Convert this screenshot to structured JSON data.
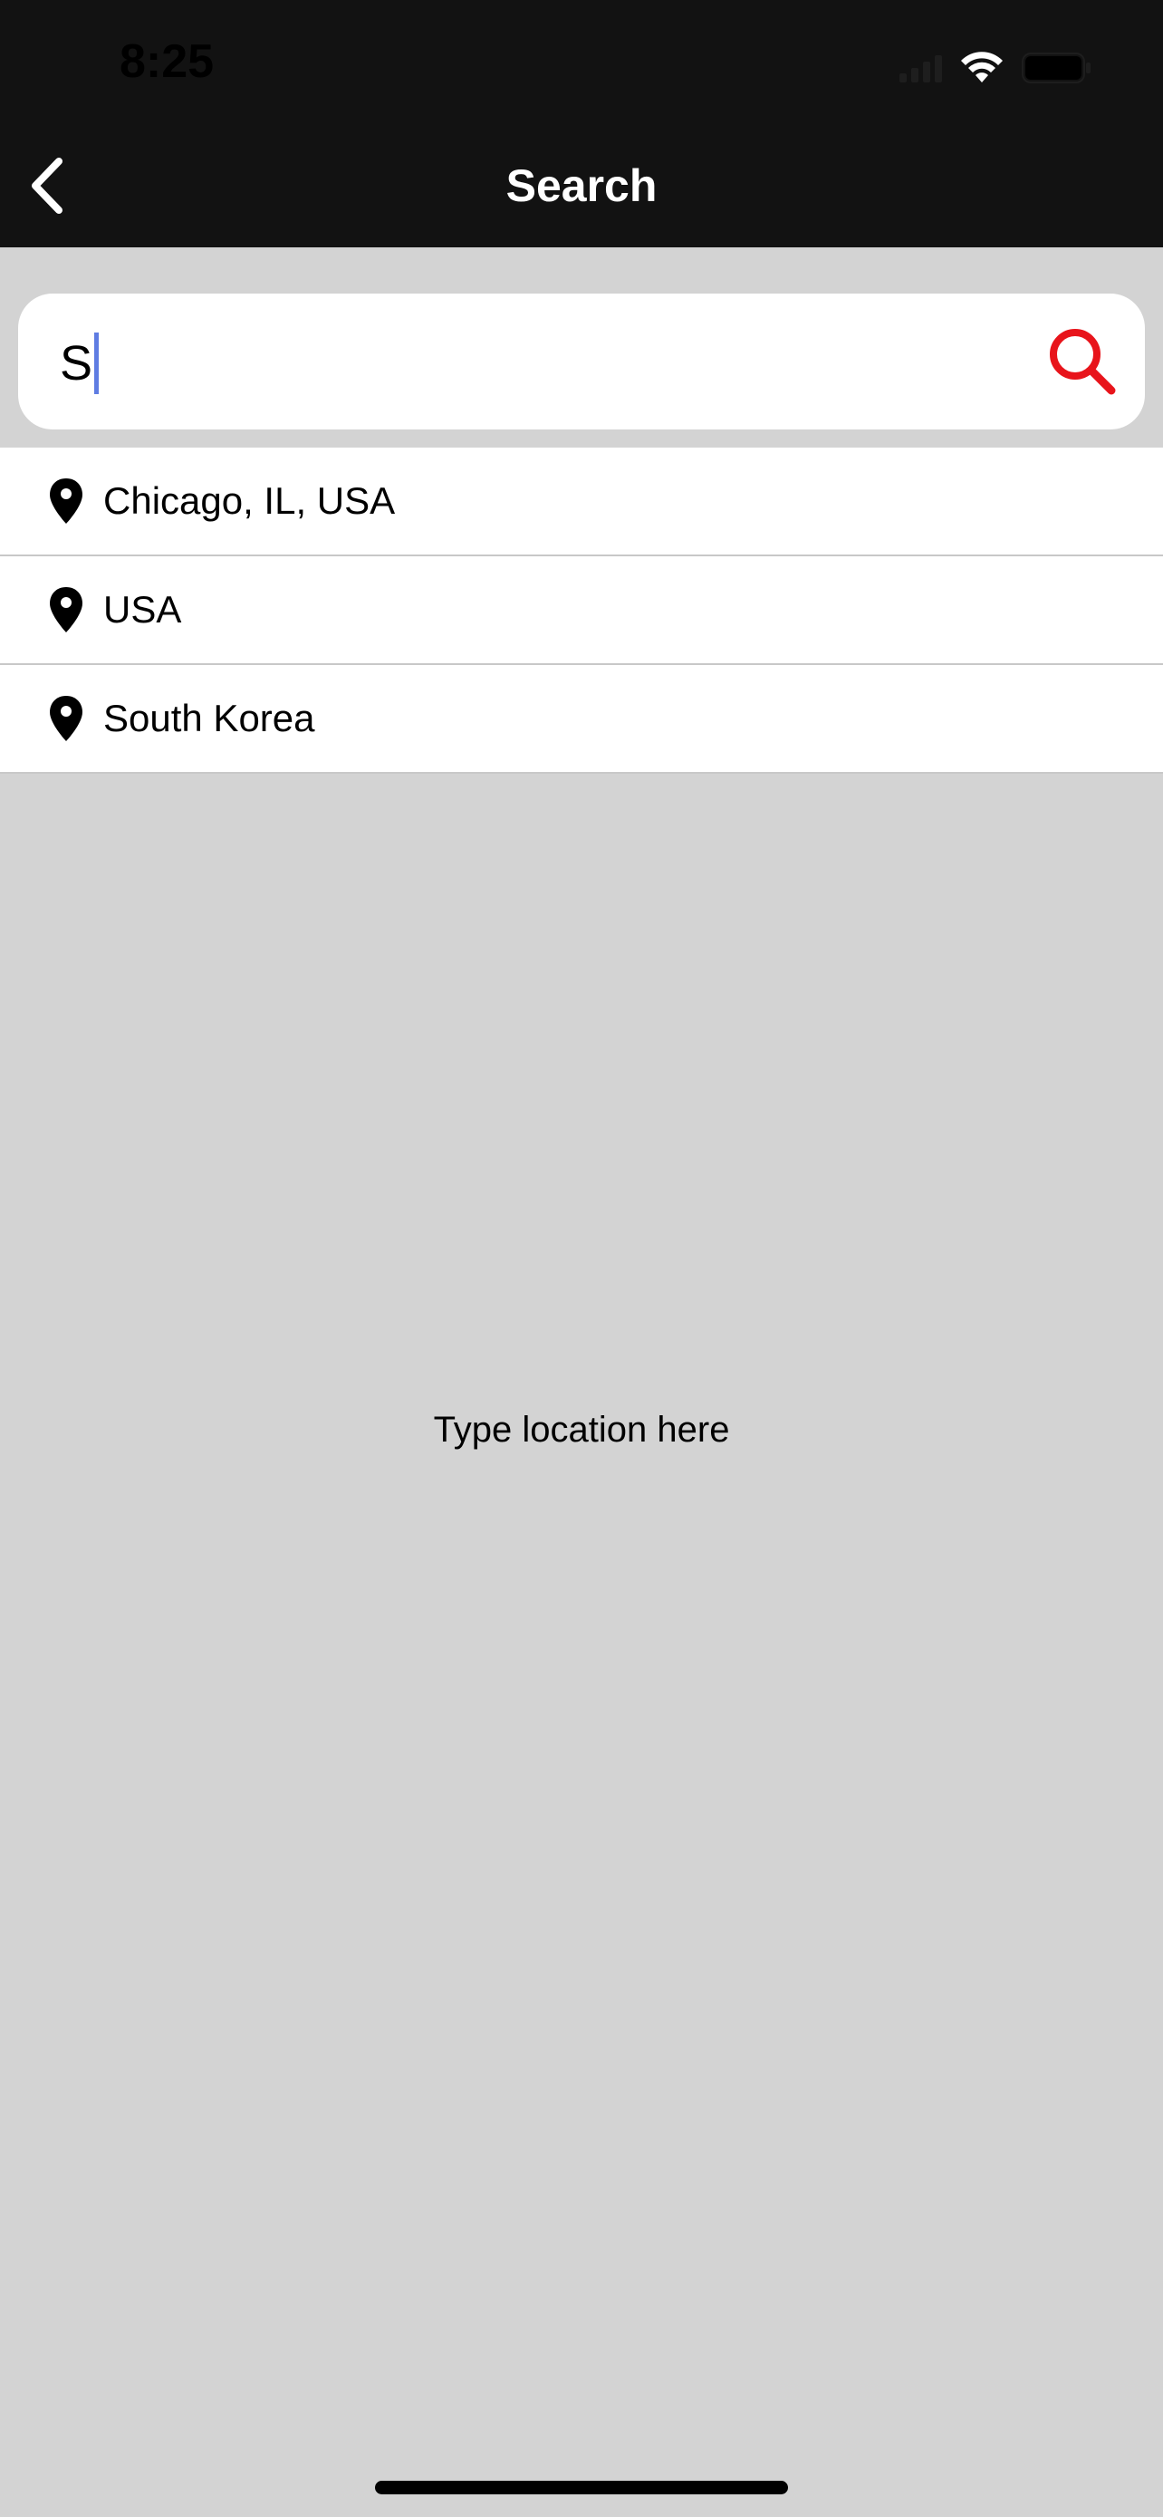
{
  "status_bar": {
    "time": "8:25",
    "icons": [
      "signal-icon",
      "wifi-icon",
      "battery-icon"
    ]
  },
  "nav": {
    "title": "Search",
    "back_icon": "chevron-left-icon"
  },
  "search": {
    "value": "S",
    "icon": "search-icon",
    "icon_color": "#e8141b"
  },
  "results": [
    {
      "label": "Chicago, IL, USA",
      "icon": "location-pin-icon"
    },
    {
      "label": "USA",
      "icon": "location-pin-icon"
    },
    {
      "label": "South Korea",
      "icon": "location-pin-icon"
    }
  ],
  "empty_hint": "Type location here",
  "colors": {
    "header_bg": "#121212",
    "page_bg": "#d3d3d3",
    "accent": "#e8141b",
    "caret": "#5e7ce2"
  }
}
